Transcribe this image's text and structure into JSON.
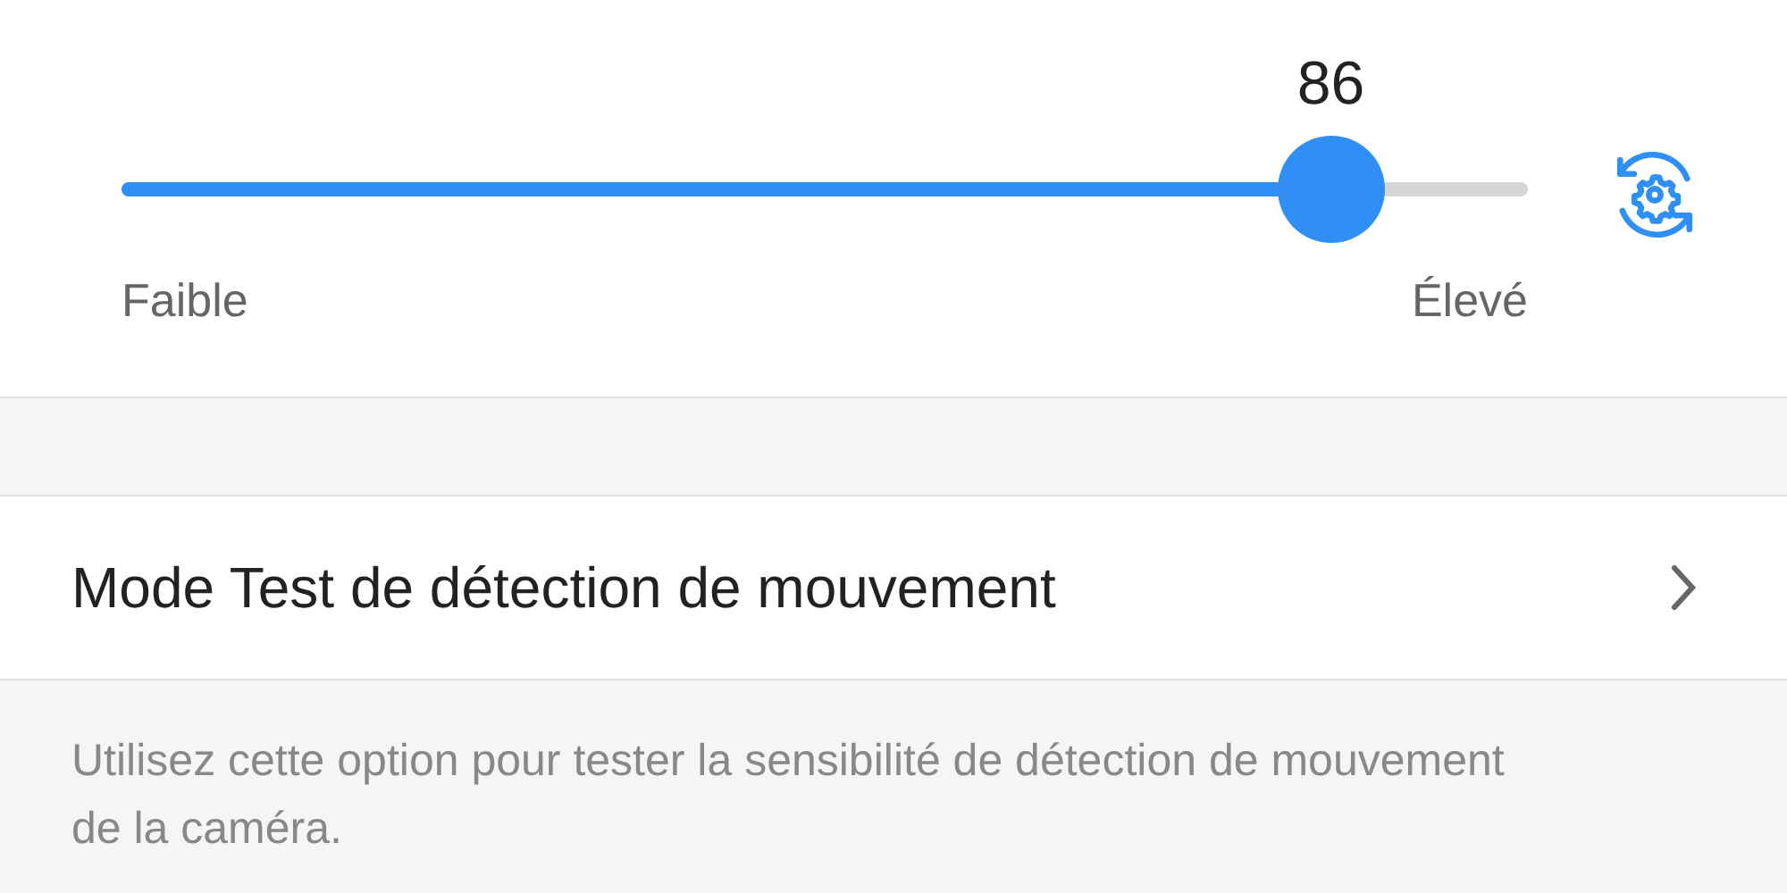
{
  "sensitivity": {
    "value": "86",
    "level": 0.86,
    "min_label": "Faible",
    "max_label": "Élevé"
  },
  "test_mode": {
    "label": "Mode Test de détection de mouvement",
    "description": "Utilisez cette option pour tester la sensibilité de détection de mouvement de la caméra."
  }
}
